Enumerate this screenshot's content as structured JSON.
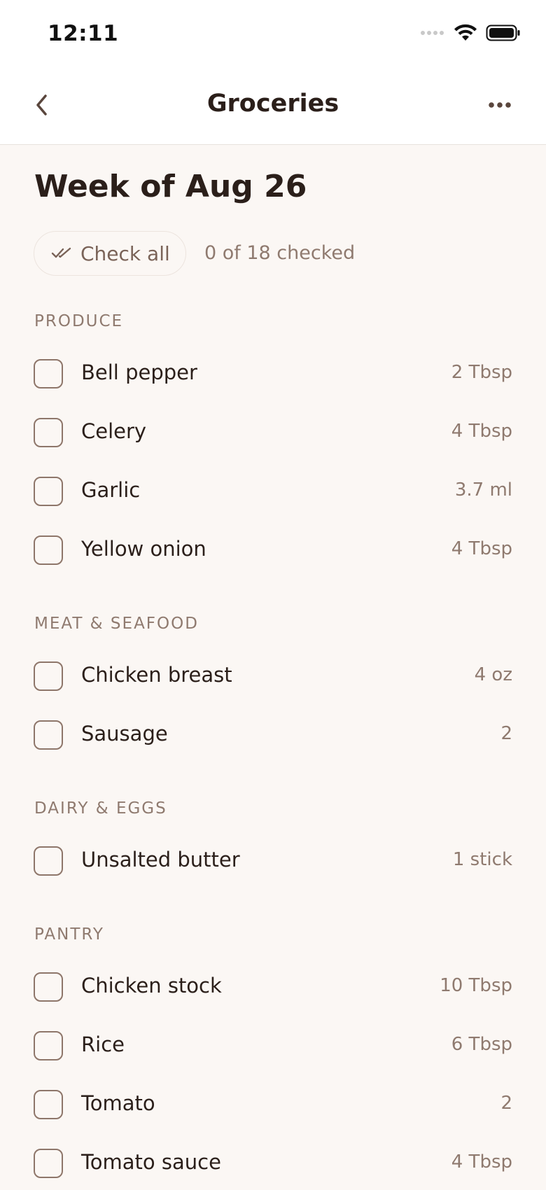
{
  "status_bar": {
    "time": "12:11"
  },
  "nav": {
    "title": "Groceries"
  },
  "header": {
    "week_title": "Week of Aug 26",
    "check_all_label": "Check all",
    "checked_count": "0 of 18 checked"
  },
  "colors": {
    "background": "#fbf7f4",
    "text": "#2b1f1a",
    "muted": "#8f7a6f",
    "checkbox_border": "#8e766a"
  },
  "sections": [
    {
      "title": "PRODUCE",
      "items": [
        {
          "name": "Bell pepper",
          "qty": "2 Tbsp",
          "checked": false
        },
        {
          "name": "Celery",
          "qty": "4 Tbsp",
          "checked": false
        },
        {
          "name": "Garlic",
          "qty": "3.7 ml",
          "checked": false
        },
        {
          "name": "Yellow onion",
          "qty": "4 Tbsp",
          "checked": false
        }
      ]
    },
    {
      "title": "MEAT & SEAFOOD",
      "items": [
        {
          "name": "Chicken breast",
          "qty": "4 oz",
          "checked": false
        },
        {
          "name": "Sausage",
          "qty": "2",
          "checked": false
        }
      ]
    },
    {
      "title": "DAIRY & EGGS",
      "items": [
        {
          "name": "Unsalted butter",
          "qty": "1 stick",
          "checked": false
        }
      ]
    },
    {
      "title": "PANTRY",
      "items": [
        {
          "name": "Chicken stock",
          "qty": "10 Tbsp",
          "checked": false
        },
        {
          "name": "Rice",
          "qty": "6 Tbsp",
          "checked": false
        },
        {
          "name": "Tomato",
          "qty": "2",
          "checked": false
        },
        {
          "name": "Tomato sauce",
          "qty": "4 Tbsp",
          "checked": false
        }
      ]
    }
  ]
}
